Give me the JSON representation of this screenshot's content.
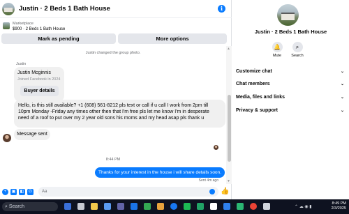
{
  "chat": {
    "title": "Justin · 2 Beds 1 Bath House",
    "info_icon": "info-icon"
  },
  "listing": {
    "label": "Marketplace",
    "price_title": "$900 · 2 Beds 1 Bath House",
    "mark_pending": "Mark as pending",
    "more_options": "More options"
  },
  "messages": {
    "system": "Justin changed the group photo.",
    "sender": "Justin",
    "card_name": "Justin Mcginnis",
    "card_sub": "Joined Facebook in 2024",
    "buyer_details": "Buyer details",
    "long_text": "Hello, is this still available? +1 (608) 561-8212 pls text or call if u call I work from 2pm till 10pm Monday -Friday any times other then that I'm free pls let me know I'm in desperate need of a roof to put over my 2 year old sons his moms and my head asap pls thank u",
    "sent_text": "Message sent",
    "time_mark": "8:44 PM",
    "outgoing": "Thanks for your interest in the house i will share details  soon.",
    "sent_ago": "Sent 4m ago"
  },
  "composer": {
    "input_value": "Aa"
  },
  "panel": {
    "title": "Justin · 2 Beds 1 Bath House",
    "mute": "Mute",
    "search": "Search",
    "rows": [
      "Customize chat",
      "Chat members",
      "Media, files and links",
      "Privacy & support"
    ]
  },
  "taskbar": {
    "search_placeholder": "Search",
    "time": "8:49 PM",
    "date": "2/3/2025",
    "apps": [
      {
        "name": "widgets-icon",
        "color": "#3a6fd8"
      },
      {
        "name": "task-view-icon",
        "color": "#c6c9d2"
      },
      {
        "name": "file-explorer-icon",
        "color": "#f2c94c"
      },
      {
        "name": "store-icon",
        "color": "#5b9bf0"
      },
      {
        "name": "teams-icon",
        "color": "#6264a7"
      },
      {
        "name": "mail-icon",
        "color": "#1a73e8"
      },
      {
        "name": "chrome-icon",
        "color": "#34a853"
      },
      {
        "name": "photos-icon",
        "color": "#e8a33d"
      },
      {
        "name": "facebook-icon",
        "color": "#1877f2"
      },
      {
        "name": "spotify-icon",
        "color": "#1db954"
      },
      {
        "name": "excel-icon",
        "color": "#21a366"
      },
      {
        "name": "phone-link-icon",
        "color": "#ffffff"
      },
      {
        "name": "vscode-icon",
        "color": "#2f80ed"
      },
      {
        "name": "edge-icon",
        "color": "#2bb673"
      },
      {
        "name": "chrome-icon-2",
        "color": "#ea4335"
      },
      {
        "name": "notepad-icon",
        "color": "#d0d4dc"
      }
    ]
  }
}
